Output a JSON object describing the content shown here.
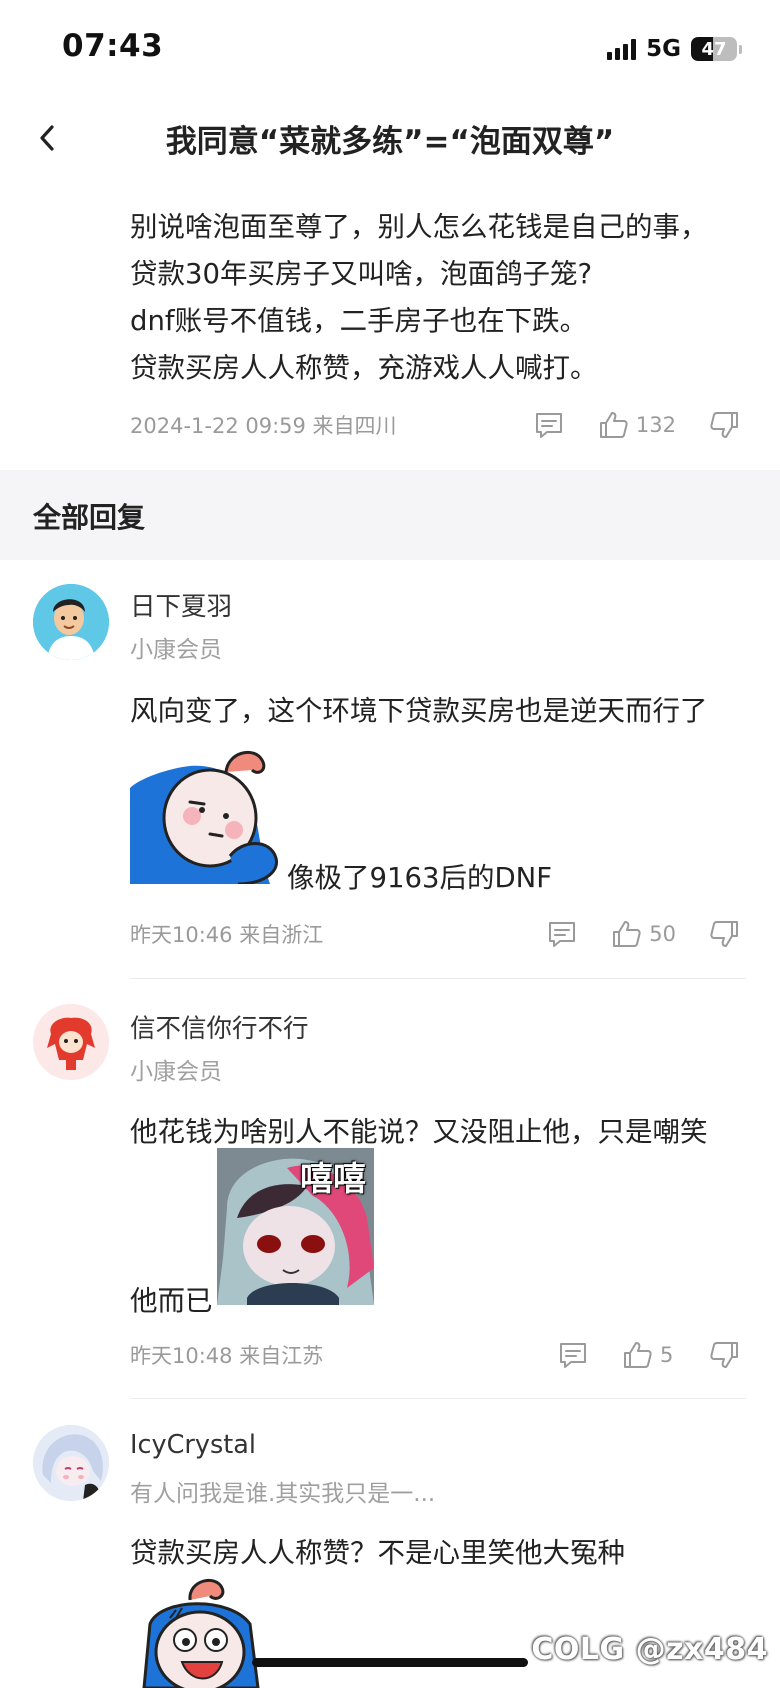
{
  "status_bar": {
    "time": "07:43",
    "network": "5G",
    "battery": "47",
    "battery_level": 0.47
  },
  "header": {
    "title": "我同意“菜就多练”=“泡面双尊”"
  },
  "post": {
    "lines": [
      "别说啥泡面至尊了，别人怎么花钱是自己的事，",
      "贷款30年买房子又叫啥，泡面鸽子笼?",
      "dnf账号不值钱，二手房子也在下跌。",
      "贷款买房人人称赞，充游戏人人喊打。"
    ],
    "meta": "2024-1-22 09:59  来自四川",
    "likes": "132"
  },
  "section_title": "全部回复",
  "comments": [
    {
      "name": "日下夏羽",
      "tag": "小康会员",
      "text": "风向变了，这个环境下贷款买房也是逆天而行了",
      "after_sticker": "像极了9163后的DNF",
      "meta": "昨天10:46  来自浙江",
      "likes": "50"
    },
    {
      "name": "信不信你行不行",
      "tag": "小康会员",
      "text": "他花钱为啥别人不能说？又没阻止他，只是嘲笑",
      "after_sticker_prefix": "他而已",
      "sticker_caption": "嘻嘻",
      "meta": "昨天10:48  来自江苏",
      "likes": "5"
    },
    {
      "name": "IcyCrystal",
      "tag": "有人问我是谁.其实我只是一...",
      "text": "贷款买房人人称赞？不是心里笑他大冤种"
    }
  ],
  "watermark": "COLG @zx484",
  "icons": [
    "back-icon",
    "comment-icon",
    "thumbs-up-icon",
    "thumbs-down-icon"
  ],
  "colors": {
    "accent_blue": "#1e73d8",
    "muted_text": "#9a9a9a",
    "band": "#f5f5f7"
  }
}
